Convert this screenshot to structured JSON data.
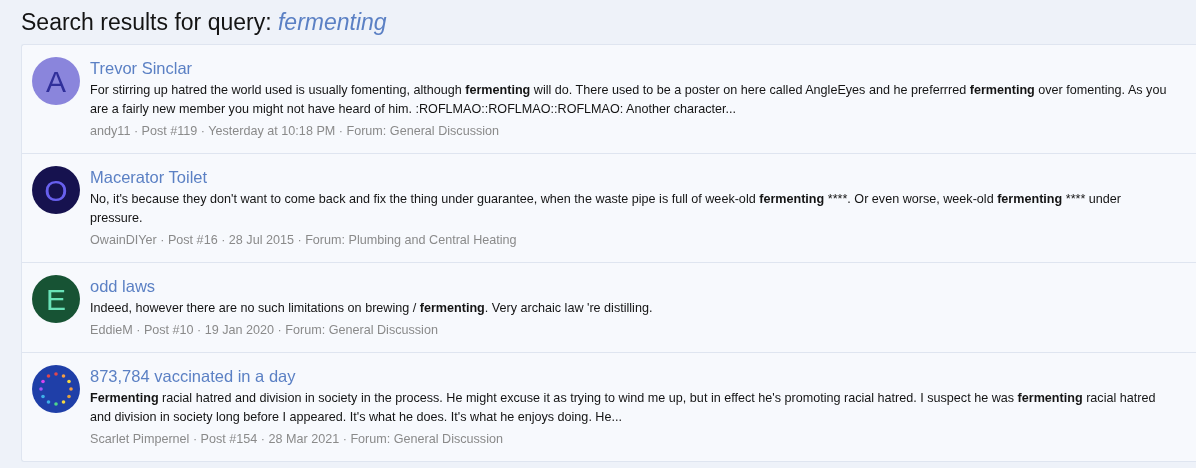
{
  "heading": {
    "prefix": "Search results for query:",
    "query": "fermenting"
  },
  "results": [
    {
      "avatar": {
        "kind": "letter",
        "letter": "A",
        "color": "#8a85dc"
      },
      "title": "Trevor Sinclar",
      "snippet": [
        {
          "text": "For stirring up hatred the world used is usually fomenting, although ",
          "bold": false
        },
        {
          "text": "fermenting",
          "bold": true
        },
        {
          "text": " will do. There used to be a poster on here called AngleEyes and he preferrred ",
          "bold": false
        },
        {
          "text": "fermenting",
          "bold": true
        },
        {
          "text": " over fomenting. As you are a fairly new member you might not have heard of him. :ROFLMAO::ROFLMAO::ROFLMAO: Another character...",
          "bold": false
        }
      ],
      "meta": "andy11 · Post #119 · Yesterday at 10:18 PM · Forum: General Discussion"
    },
    {
      "avatar": {
        "kind": "letter",
        "letter": "O",
        "color": "#16124f"
      },
      "title": "Macerator Toilet",
      "snippet": [
        {
          "text": "No, it's because they don't want to come back and fix the thing under guarantee, when the waste pipe is full of week-old ",
          "bold": false
        },
        {
          "text": "fermenting",
          "bold": true
        },
        {
          "text": " ****. Or even worse, week-old ",
          "bold": false
        },
        {
          "text": "fermenting",
          "bold": true
        },
        {
          "text": " **** under pressure.",
          "bold": false
        }
      ],
      "meta": "OwainDIYer · Post #16 · 28 Jul 2015 · Forum: Plumbing and Central Heating"
    },
    {
      "avatar": {
        "kind": "letter",
        "letter": "E",
        "color": "#175334"
      },
      "title": "odd laws",
      "snippet": [
        {
          "text": "Indeed, however there are no such limitations on brewing / ",
          "bold": false
        },
        {
          "text": "fermenting",
          "bold": true
        },
        {
          "text": ". Very archaic law 're distilling.",
          "bold": false
        }
      ],
      "meta": "EddieM · Post #10 · 19 Jan 2020 · Forum: General Discussion"
    },
    {
      "avatar": {
        "kind": "picture"
      },
      "title": "873,784 vaccinated in a day",
      "snippet": [
        {
          "text": "Fermenting",
          "bold": true
        },
        {
          "text": " racial hatred and division in society in the process. He might excuse it as trying to wind me up, but in effect he's promoting racial hatred. I suspect he was ",
          "bold": false
        },
        {
          "text": "fermenting",
          "bold": true
        },
        {
          "text": " racial hatred and division in society long before I appeared. It's what he does. It's what he enjoys doing. He...",
          "bold": false
        }
      ],
      "meta": "Scarlet Pimpernel · Post #154 · 28 Mar 2021 · Forum: General Discussion"
    }
  ]
}
